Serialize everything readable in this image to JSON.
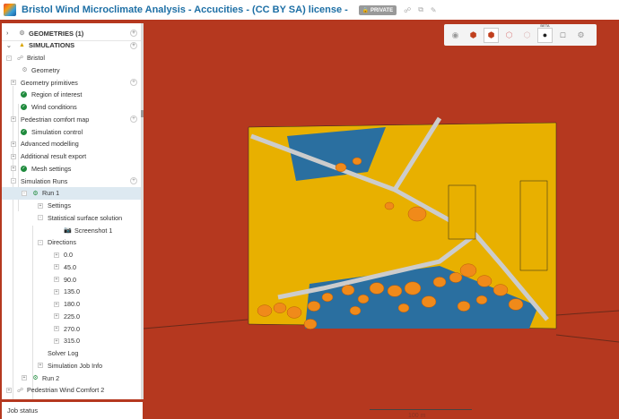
{
  "header": {
    "title": "Bristol Wind Microclimate Analysis - Accucities - (CC BY SA) license -",
    "badge": "PRIVATE",
    "icons": [
      "share-icon",
      "copy-icon",
      "edit-icon"
    ]
  },
  "tree": [
    {
      "label": "GEOMETRIES (1)",
      "level": 0,
      "toggle": ">",
      "icon": "geometry-icon",
      "hdr": true,
      "plus": true
    },
    {
      "label": "SIMULATIONS",
      "level": 0,
      "toggle": "v",
      "icon": "simulations-icon",
      "hdr": true,
      "plus": true
    },
    {
      "label": "Bristol",
      "level": 1,
      "toggle": "-",
      "icon": "simulation-icon"
    },
    {
      "label": "Geometry",
      "level": 2,
      "icon": "geometry-icon"
    },
    {
      "label": "Geometry primitives",
      "level": 2,
      "toggle": "+",
      "plus": true
    },
    {
      "label": "Region of interest",
      "level": 2,
      "check": true
    },
    {
      "label": "Wind conditions",
      "level": 2,
      "check": true
    },
    {
      "label": "Pedestrian comfort map",
      "level": 2,
      "toggle": "+",
      "plus": true
    },
    {
      "label": "Simulation control",
      "level": 2,
      "check": true
    },
    {
      "label": "Advanced modelling",
      "level": 2,
      "toggle": "+"
    },
    {
      "label": "Additional result export",
      "level": 2,
      "toggle": "+"
    },
    {
      "label": "Mesh settings",
      "level": 2,
      "toggle": "+",
      "check": true
    },
    {
      "label": "Simulation Runs",
      "level": 2,
      "toggle": "-",
      "plus": true
    },
    {
      "label": "Run 1",
      "level": 3,
      "toggle": "-",
      "icon": "run-gears-icon",
      "selected": true
    },
    {
      "label": "Settings",
      "level": 4,
      "toggle": "+"
    },
    {
      "label": "Statistical surface solution",
      "level": 4,
      "toggle": "-"
    },
    {
      "label": "Screenshot 1",
      "level": 5,
      "icon": "camera-icon"
    },
    {
      "label": "Directions",
      "level": 4,
      "toggle": "-"
    },
    {
      "label": "0.0",
      "level": 5,
      "toggle": "+"
    },
    {
      "label": "45.0",
      "level": 5,
      "toggle": "+"
    },
    {
      "label": "90.0",
      "level": 5,
      "toggle": "+"
    },
    {
      "label": "135.0",
      "level": 5,
      "toggle": "+"
    },
    {
      "label": "180.0",
      "level": 5,
      "toggle": "+"
    },
    {
      "label": "225.0",
      "level": 5,
      "toggle": "+"
    },
    {
      "label": "270.0",
      "level": 5,
      "toggle": "+"
    },
    {
      "label": "315.0",
      "level": 5,
      "toggle": "+"
    },
    {
      "label": "Solver Log",
      "level": 4
    },
    {
      "label": "Simulation Job Info",
      "level": 4,
      "toggle": "+"
    },
    {
      "label": "Run 2",
      "level": 3,
      "toggle": "+",
      "icon": "run-gears-icon"
    },
    {
      "label": "Pedestrian Wind Comfort 2",
      "level": 1,
      "toggle": "+",
      "icon": "simulation-icon"
    }
  ],
  "job_status": "Job status",
  "toolbar": {
    "items": [
      "reset-view-icon",
      "solid-view-icon",
      "solid-edges-view-icon",
      "wireframe-icon",
      "transparent-icon",
      "probe-point-icon",
      "box-select-icon",
      "settings-icon"
    ],
    "beta_label": "BETA"
  },
  "scale": {
    "label": "100 m"
  },
  "colors": {
    "viewport": "#b5381f",
    "buildings": "#e8b000",
    "trees": "#f08a1a",
    "water": "#2a6fa0",
    "title": "#1d6fa5"
  }
}
